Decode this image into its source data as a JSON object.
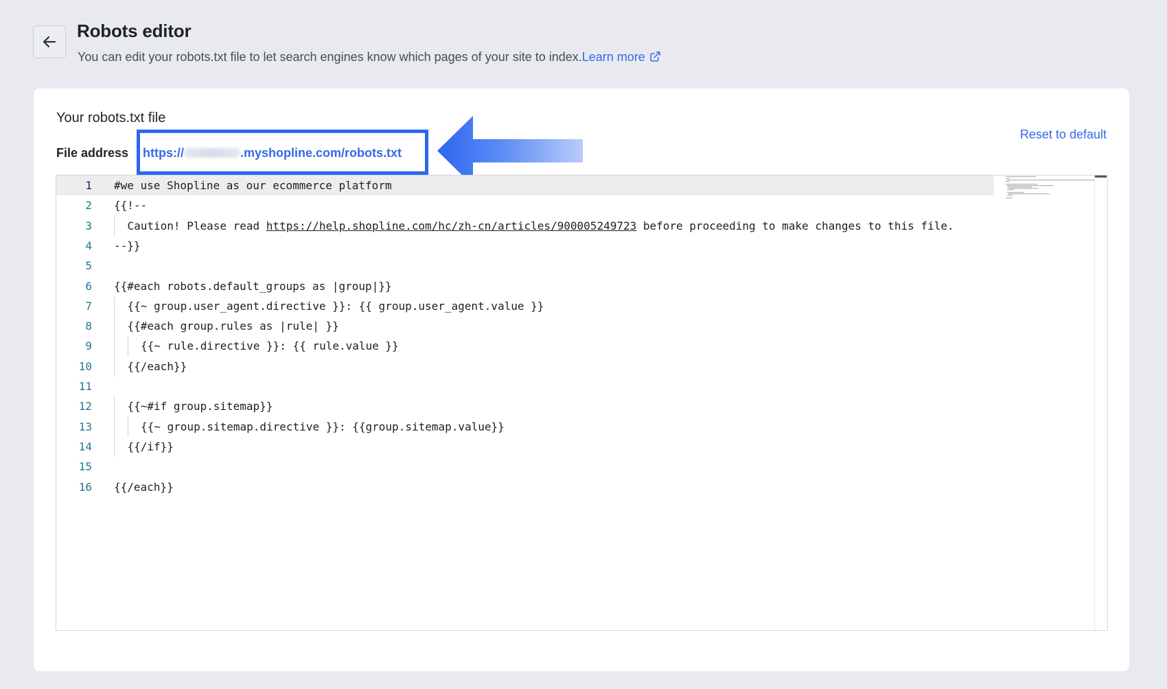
{
  "header": {
    "title": "Robots editor",
    "description": "You can edit your robots.txt file to let search engines know which pages of your site to index.",
    "learn_more": "Learn more"
  },
  "card": {
    "title": "Your robots.txt file",
    "file_address_label": "File address",
    "file_address_prefix": "https://",
    "file_address_suffix": ".myshopline.com/robots.txt",
    "reset_label": "Reset to default"
  },
  "editor": {
    "active_line": 1,
    "lines": [
      {
        "n": "1",
        "indent": 0,
        "text": "#we use Shopline as our ecommerce platform"
      },
      {
        "n": "2",
        "indent": 0,
        "text": "{{!--"
      },
      {
        "n": "3",
        "indent": 1,
        "text": "Caution! Please read ",
        "link": "https://help.shopline.com/hc/zh-cn/articles/900005249723",
        "after": " before proceeding to make changes to this file."
      },
      {
        "n": "4",
        "indent": 0,
        "text": "--}}"
      },
      {
        "n": "5",
        "indent": 0,
        "text": ""
      },
      {
        "n": "6",
        "indent": 0,
        "text": "{{#each robots.default_groups as |group|}}"
      },
      {
        "n": "7",
        "indent": 1,
        "text": "{{~ group.user_agent.directive }}: {{ group.user_agent.value }}"
      },
      {
        "n": "8",
        "indent": 1,
        "text": "{{#each group.rules as |rule| }}"
      },
      {
        "n": "9",
        "indent": 2,
        "text": "{{~ rule.directive }}: {{ rule.value }}"
      },
      {
        "n": "10",
        "indent": 1,
        "text": "{{/each}}"
      },
      {
        "n": "11",
        "indent": 0,
        "text": ""
      },
      {
        "n": "12",
        "indent": 1,
        "text": "{{~#if group.sitemap}}"
      },
      {
        "n": "13",
        "indent": 2,
        "text": "{{~ group.sitemap.directive }}: {{group.sitemap.value}}"
      },
      {
        "n": "14",
        "indent": 1,
        "text": "{{/if}}"
      },
      {
        "n": "15",
        "indent": 0,
        "text": ""
      },
      {
        "n": "16",
        "indent": 0,
        "text": "{{/each}}"
      }
    ]
  },
  "colors": {
    "accent": "#356ae6",
    "highlight_box": "#2d66f0",
    "background": "#e8eaef"
  },
  "icons": [
    "arrow-left-icon",
    "external-link-icon",
    "callout-arrow-icon"
  ]
}
